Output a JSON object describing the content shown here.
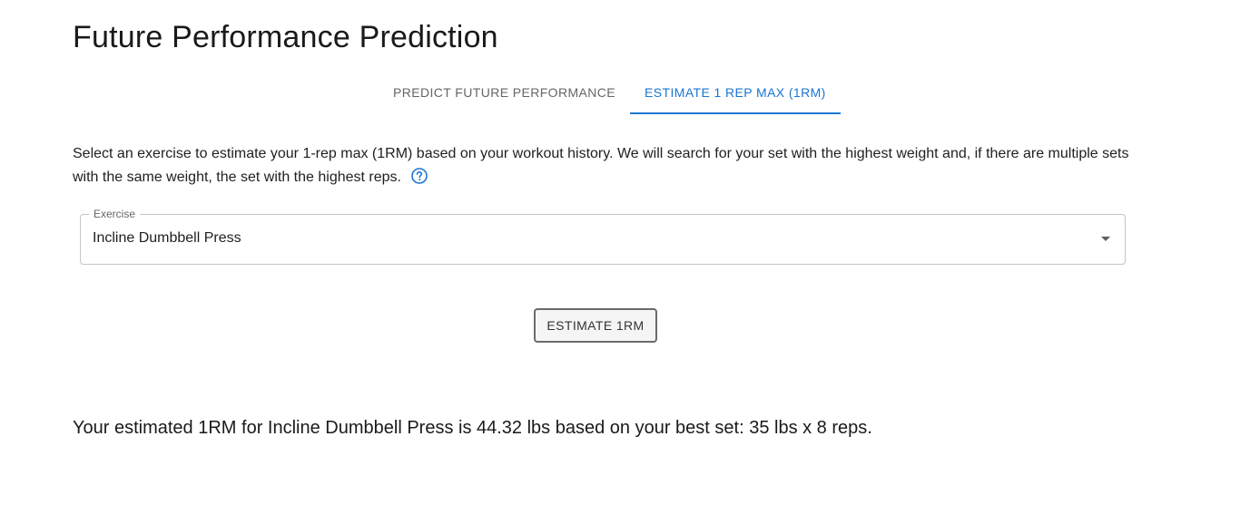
{
  "page": {
    "title": "Future Performance Prediction"
  },
  "tabs": [
    {
      "label": "PREDICT FUTURE PERFORMANCE",
      "active": false
    },
    {
      "label": "ESTIMATE 1 REP MAX (1RM)",
      "active": true
    }
  ],
  "description": {
    "text": "Select an exercise to estimate your 1-rep max (1RM) based on your workout history. We will search for your set with the highest weight and, if there are multiple sets with the same weight, the set with the highest reps.",
    "help_icon": "help-circle-icon"
  },
  "exercise_select": {
    "label": "Exercise",
    "value": "Incline Dumbbell Press",
    "icon": "chevron-down-icon"
  },
  "actions": {
    "estimate_label": "ESTIMATE 1RM"
  },
  "result": {
    "text": "Your estimated 1RM for Incline Dumbbell Press is 44.32 lbs based on your best set: 35 lbs x 8 reps."
  },
  "colors": {
    "accent": "#1976d2",
    "text": "#1f1f1f",
    "muted": "#666666",
    "border": "#c4c4c4"
  }
}
